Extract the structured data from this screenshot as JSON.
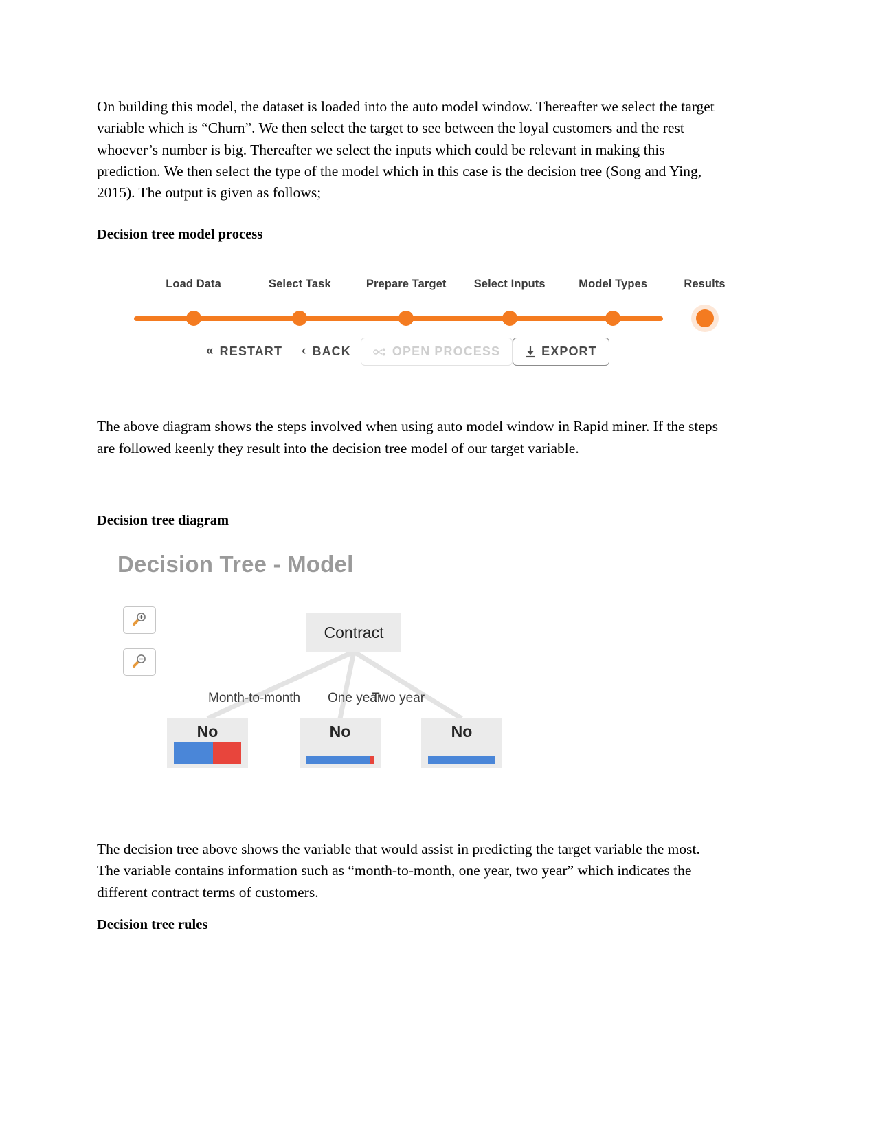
{
  "document": {
    "paragraph_1": "On building this model, the dataset is loaded into the auto model window. Thereafter we select the target variable which is “Churn”. We then select the target to see between the loyal customers and the rest whoever’s number is big. Thereafter we select the inputs which could be relevant in making this prediction. We then select the type of the model which in this case is the decision tree (Song and Ying, 2015).  The output is given as follows;",
    "heading_1": "Decision tree model process",
    "paragraph_2": "The above diagram shows the steps involved when using auto model window in Rapid miner. If the steps are followed keenly they result into the decision tree model of our target variable.",
    "heading_2": "Decision tree diagram",
    "paragraph_3": "The decision tree above shows the variable that would assist in predicting the target variable the most. The variable contains information such as “month-to-month, one year, two year” which indicates the different contract terms of customers.",
    "heading_3": "Decision tree rules"
  },
  "process_widget": {
    "steps": [
      {
        "label": "Load Data",
        "x_pct": 0,
        "active": true
      },
      {
        "label": "Select Task",
        "x_pct": 20,
        "active": true
      },
      {
        "label": "Prepare Target",
        "x_pct": 40,
        "active": true
      },
      {
        "label": "Select Inputs",
        "x_pct": 60,
        "active": true
      },
      {
        "label": "Model Types",
        "x_pct": 80,
        "active": true
      },
      {
        "label": "Results",
        "x_pct": 100,
        "active": true,
        "current": true
      }
    ],
    "accent_color": "#f47b20",
    "buttons": [
      {
        "name": "restart",
        "label": "RESTART",
        "icon": "double-chevron-left-icon",
        "glyph": "«",
        "style": "plain",
        "disabled": false
      },
      {
        "name": "back",
        "label": "BACK",
        "icon": "chevron-left-icon",
        "glyph": "‹",
        "style": "plain",
        "disabled": false
      },
      {
        "name": "open-process",
        "label": "OPEN PROCESS",
        "icon": "process-node-icon",
        "glyph": "",
        "style": "boxed",
        "disabled": true
      },
      {
        "name": "export",
        "label": "EXPORT",
        "icon": "download-icon",
        "glyph": "",
        "style": "boxed-strong",
        "disabled": false
      }
    ]
  },
  "tree_figure": {
    "title": "Decision Tree - Model",
    "zoom_in_label": "zoom in",
    "zoom_out_label": "zoom out",
    "root": {
      "label": "Contract"
    },
    "branches": [
      {
        "label": "Month-to-month"
      },
      {
        "label": "One year"
      },
      {
        "label": "Two year"
      }
    ],
    "leaves": [
      {
        "label": "No",
        "bar_height": "tall",
        "segments": [
          {
            "color": "#4a86d8",
            "pct": 58
          },
          {
            "color": "#e8453c",
            "pct": 42
          }
        ]
      },
      {
        "label": "No",
        "bar_height": "short",
        "segments": [
          {
            "color": "#4a86d8",
            "pct": 94
          },
          {
            "color": "#e8453c",
            "pct": 6
          }
        ]
      },
      {
        "label": "No",
        "bar_height": "short",
        "segments": [
          {
            "color": "#4a86d8",
            "pct": 100
          }
        ]
      }
    ],
    "node_fill": "#ebebeb",
    "blue": "#4a86d8",
    "red": "#e8453c"
  }
}
